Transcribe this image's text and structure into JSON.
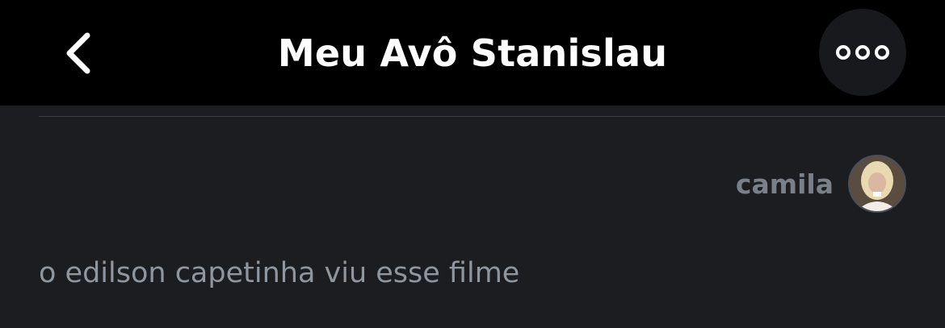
{
  "header": {
    "title": "Meu Avô Stanislau",
    "back_icon": "chevron-left-icon",
    "more_icon": "ellipsis-icon"
  },
  "comment": {
    "author": "camila",
    "text": "o edilson capetinha viu esse filme"
  },
  "colors": {
    "header_bg": "#000000",
    "body_bg": "#1b1d21",
    "author_text": "#79808a",
    "comment_text": "#8f96a0"
  }
}
